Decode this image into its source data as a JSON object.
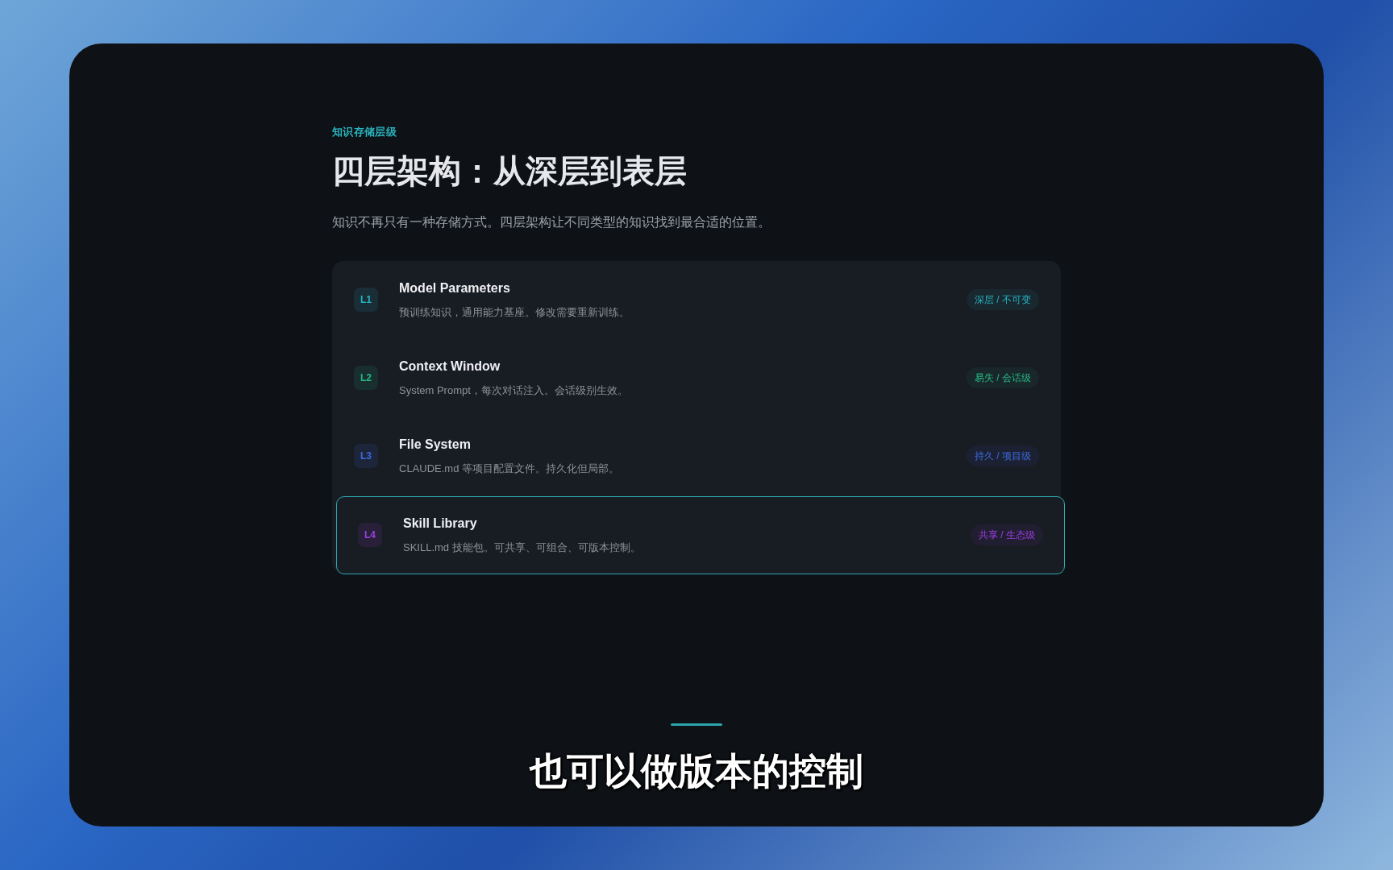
{
  "eyebrow": "知识存储层级",
  "title": "四层架构：从深层到表层",
  "description": "知识不再只有一种存储方式。四层架构让不同类型的知识找到最合适的位置。",
  "layers": [
    {
      "badge": "L1",
      "name": "Model Parameters",
      "detail": "预训练知识，通用能力基座。修改需要重新训练。",
      "tag": "深层 / 不可变",
      "color": "#25b5c4",
      "selected": false
    },
    {
      "badge": "L2",
      "name": "Context Window",
      "detail": "System Prompt，每次对话注入。会话级别生效。",
      "tag": "易失 / 会话级",
      "color": "#25b884",
      "selected": false
    },
    {
      "badge": "L3",
      "name": "File System",
      "detail": "CLAUDE.md 等项目配置文件。持久化但局部。",
      "tag": "持久 / 项目级",
      "color": "#3d6be0",
      "selected": false
    },
    {
      "badge": "L4",
      "name": "Skill Library",
      "detail": "SKILL.md 技能包。可共享、可组合、可版本控制。",
      "tag": "共享 / 生态级",
      "color": "#9a3fe0",
      "selected": true
    }
  ],
  "subtitle": "也可以做版本的控制"
}
